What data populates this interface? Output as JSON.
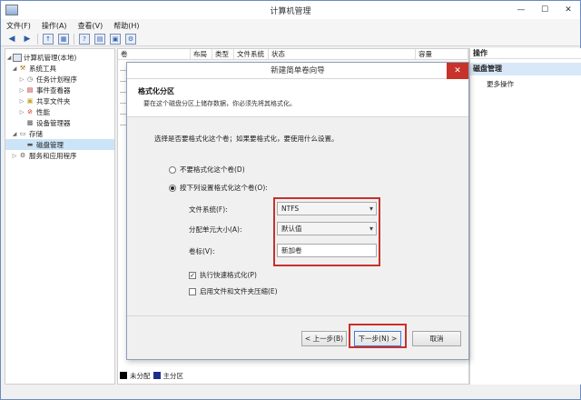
{
  "window": {
    "title": "计算机管理",
    "controls": [
      "—",
      "☐",
      "✕"
    ]
  },
  "menu": [
    "文件(F)",
    "操作(A)",
    "查看(V)",
    "帮助(H)"
  ],
  "tree": [
    {
      "label": "计算机管理(本地)",
      "indent": 0,
      "arrow": "◢"
    },
    {
      "label": "系统工具",
      "indent": 1,
      "arrow": "◢"
    },
    {
      "label": "任务计划程序",
      "indent": 2,
      "arrow": "▷"
    },
    {
      "label": "事件查看器",
      "indent": 2,
      "arrow": "▷"
    },
    {
      "label": "共享文件夹",
      "indent": 2,
      "arrow": "▷"
    },
    {
      "label": "性能",
      "indent": 2,
      "arrow": "▷"
    },
    {
      "label": "设备管理器",
      "indent": 2,
      "arrow": ""
    },
    {
      "label": "存储",
      "indent": 1,
      "arrow": "◢"
    },
    {
      "label": "磁盘管理",
      "indent": 2,
      "arrow": "",
      "selected": true
    },
    {
      "label": "服务和应用程序",
      "indent": 1,
      "arrow": "▷"
    }
  ],
  "columns": [
    "卷",
    "布局",
    "类型",
    "文件系统",
    "状态",
    "容量"
  ],
  "legend": {
    "unallocated": "未分配",
    "primary": "主分区"
  },
  "actions": {
    "header": "操作",
    "selected": "磁盘管理",
    "more": "更多操作"
  },
  "wizard": {
    "title": "新建简单卷向导",
    "heading": "格式化分区",
    "subheading": "要在这个磁盘分区上储存数据，你必须先将其格式化。",
    "instruction": "选择是否要格式化这个卷；如果要格式化，要使用什么设置。",
    "radio_no_format": "不要格式化这个卷(D)",
    "radio_format": "按下列设置格式化这个卷(O):",
    "fs_label": "文件系统(F):",
    "fs_value": "NTFS",
    "alloc_label": "分配单元大小(A):",
    "alloc_value": "默认值",
    "volume_label": "卷标(V):",
    "volume_value": "新加卷",
    "quick_format": "执行快速格式化(P)",
    "compression": "启用文件和文件夹压缩(E)",
    "back_button": "< 上一步(B)",
    "next_button": "下一步(N) >",
    "cancel_button": "取消"
  },
  "colors": {
    "highlight": "#c9302c",
    "selection": "#cce4f7",
    "close": "#c7322b"
  }
}
